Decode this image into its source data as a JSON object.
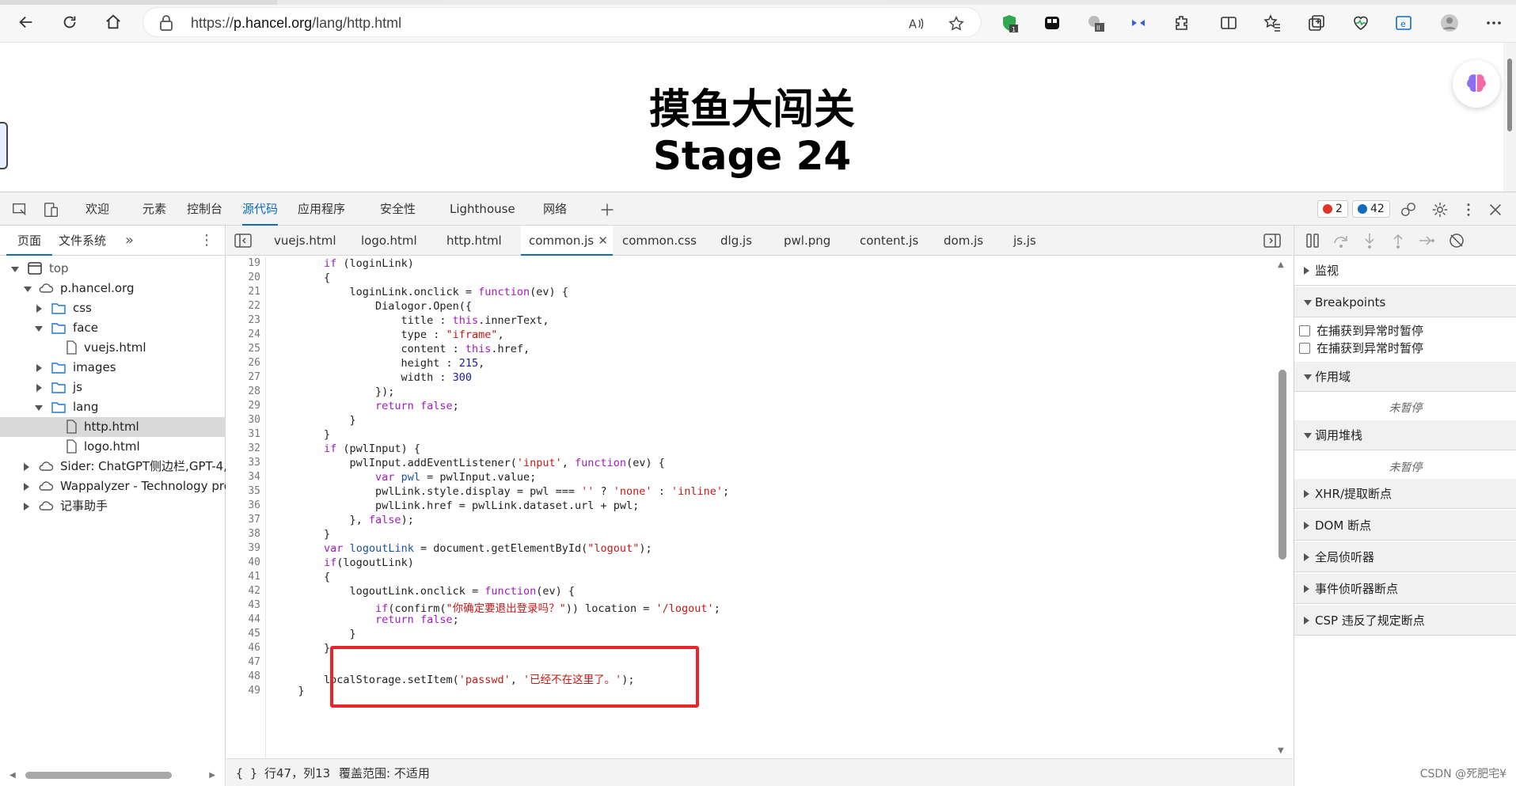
{
  "browser": {
    "url_prefix": "https://",
    "url_host": "p.hancel.org",
    "url_path": "/lang/http.html"
  },
  "page": {
    "title": "摸鱼大闯关",
    "stage": "Stage 24"
  },
  "devtools": {
    "tabs": [
      "欢迎",
      "元素",
      "控制台",
      "源代码",
      "应用程序",
      "安全性",
      "Lighthouse",
      "网络"
    ],
    "active_tab": "源代码",
    "errors": "2",
    "messages": "42",
    "navigator_tabs": [
      "页面",
      "文件系统"
    ],
    "tree": [
      {
        "label": "top",
        "icon": "frame-icon"
      },
      {
        "label": "p.hancel.org",
        "icon": "cloud-icon"
      },
      {
        "label": "css",
        "icon": "folder-icon"
      },
      {
        "label": "face",
        "icon": "folder-icon"
      },
      {
        "label": "vuejs.html",
        "icon": "file-icon"
      },
      {
        "label": "images",
        "icon": "folder-icon"
      },
      {
        "label": "js",
        "icon": "folder-icon"
      },
      {
        "label": "lang",
        "icon": "folder-icon"
      },
      {
        "label": "http.html",
        "icon": "file-icon"
      },
      {
        "label": "logo.html",
        "icon": "file-icon"
      },
      {
        "label": "Sider: ChatGPT侧边栏,GPT-4, 联",
        "icon": "cloud-icon"
      },
      {
        "label": "Wappalyzer - Technology profil",
        "icon": "cloud-icon"
      },
      {
        "label": "记事助手",
        "icon": "cloud-icon"
      }
    ],
    "file_tabs": [
      "vuejs.html",
      "logo.html",
      "http.html",
      "common.js",
      "common.css",
      "dlg.js",
      "pwl.png",
      "content.js",
      "dom.js",
      "js.js"
    ],
    "active_file": "common.js",
    "line_numbers": [
      "19",
      "20",
      "21",
      "22",
      "23",
      "24",
      "25",
      "26",
      "27",
      "28",
      "29",
      "30",
      "31",
      "32",
      "33",
      "34",
      "35",
      "36",
      "37",
      "38",
      "39",
      "40",
      "41",
      "42",
      "43",
      "44",
      "45",
      "46",
      "47",
      "48",
      "49"
    ],
    "status_cursor": "行47，列13",
    "status_coverage": "覆盖范围: 不适用",
    "debugger_sections": [
      "监视",
      "Breakpoints",
      "作用域",
      "调用堆栈",
      "XHR/提取断点",
      "DOM 断点",
      "全局侦听器",
      "事件侦听器断点",
      "CSP 违反了规定断点"
    ],
    "checkbox_labels": [
      "在捕获到异常时暂停",
      "在捕获到异常时暂停"
    ],
    "not_paused": "未暂停"
  },
  "watermark": "CSDN @死肥宅¥",
  "colors": {
    "accent": "#0f6cbd",
    "highlight_box": "#e8262a",
    "keyword": "#a11bc1",
    "string": "#c41a16"
  }
}
